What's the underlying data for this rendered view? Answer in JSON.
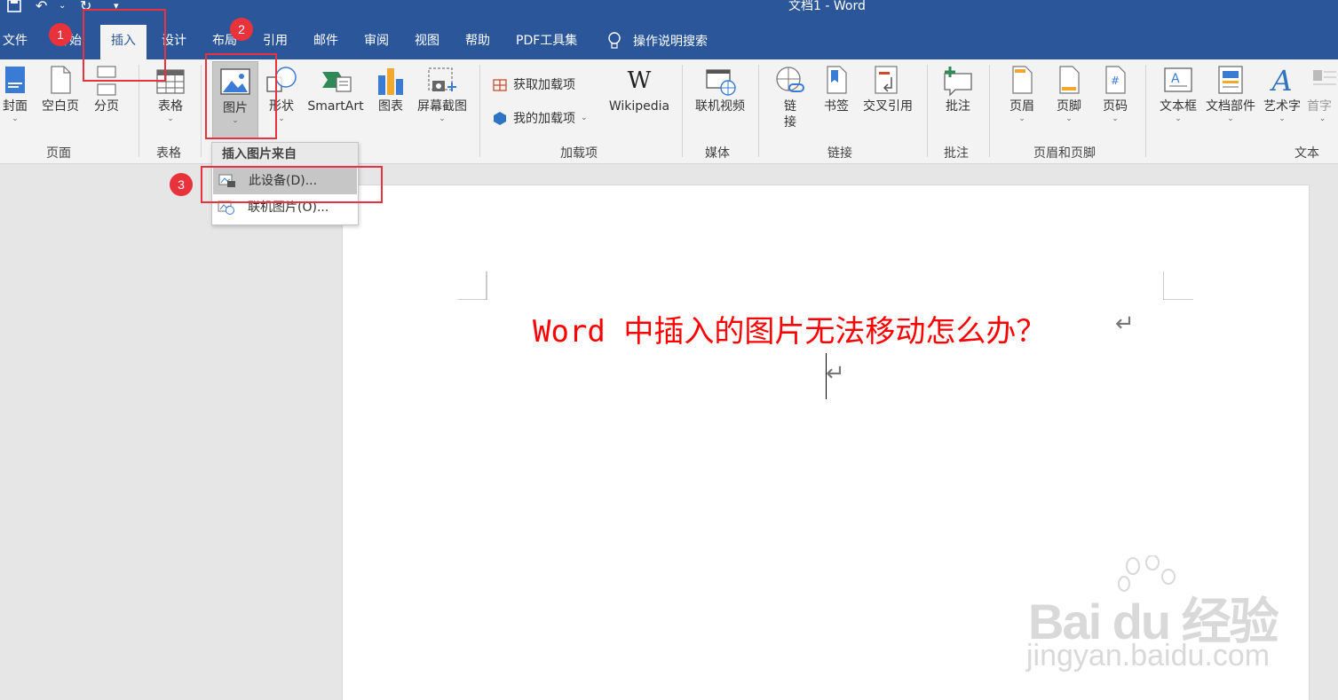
{
  "window": {
    "title": "文档1  -  Word"
  },
  "qat": {
    "undo_icon": "↶",
    "redo_icon": "↻",
    "customize_icon": "▾"
  },
  "tabs": [
    {
      "label": "文件"
    },
    {
      "label": "开始"
    },
    {
      "label": "插入"
    },
    {
      "label": "设计"
    },
    {
      "label": "布局"
    },
    {
      "label": "引用"
    },
    {
      "label": "邮件"
    },
    {
      "label": "审阅"
    },
    {
      "label": "视图"
    },
    {
      "label": "帮助"
    },
    {
      "label": "PDF工具集"
    }
  ],
  "tell_me": "操作说明搜索",
  "ribbon": {
    "pages": {
      "cover": "封面",
      "blank": "空白页",
      "break": "分页",
      "group": "页面"
    },
    "tables": {
      "table": "表格",
      "group": "表格"
    },
    "illustrations": {
      "pictures": "图片",
      "shapes": "形状",
      "smartart": "SmartArt",
      "chart": "图表",
      "screenshot": "屏幕截图"
    },
    "addins": {
      "get": "获取加载项",
      "mine": "我的加载项",
      "wikipedia": "Wikipedia",
      "group": "加载项"
    },
    "media": {
      "video": "联机视频",
      "group": "媒体"
    },
    "links": {
      "link": "链\n接",
      "bookmark": "书签",
      "crossref": "交叉引用",
      "group": "链接"
    },
    "comments": {
      "comment": "批注",
      "group": "批注"
    },
    "headerfooter": {
      "header": "页眉",
      "footer": "页脚",
      "pagenum": "页码",
      "group": "页眉和页脚"
    },
    "text": {
      "textbox": "文本框",
      "quickparts": "文档部件",
      "wordart": "艺术字",
      "dropcap": "首字",
      "group": "文本"
    }
  },
  "dropdown": {
    "header": "插入图片来自",
    "items": [
      {
        "label": "此设备(D)..."
      },
      {
        "label": "联机图片(O)..."
      }
    ]
  },
  "document": {
    "heading": "Word 中插入的图片无法移动怎么办？",
    "para_mark": "↵"
  },
  "annotations": {
    "badge1": "1",
    "badge2": "2",
    "badge3": "3"
  },
  "watermark": {
    "brand": "Bai du 经验",
    "url": "jingyan.baidu.com"
  },
  "colors": {
    "title_bar": "#2b579a",
    "ribbon": "#f3f3f3",
    "annotation": "#e8323c",
    "heading": "#ff0000"
  }
}
